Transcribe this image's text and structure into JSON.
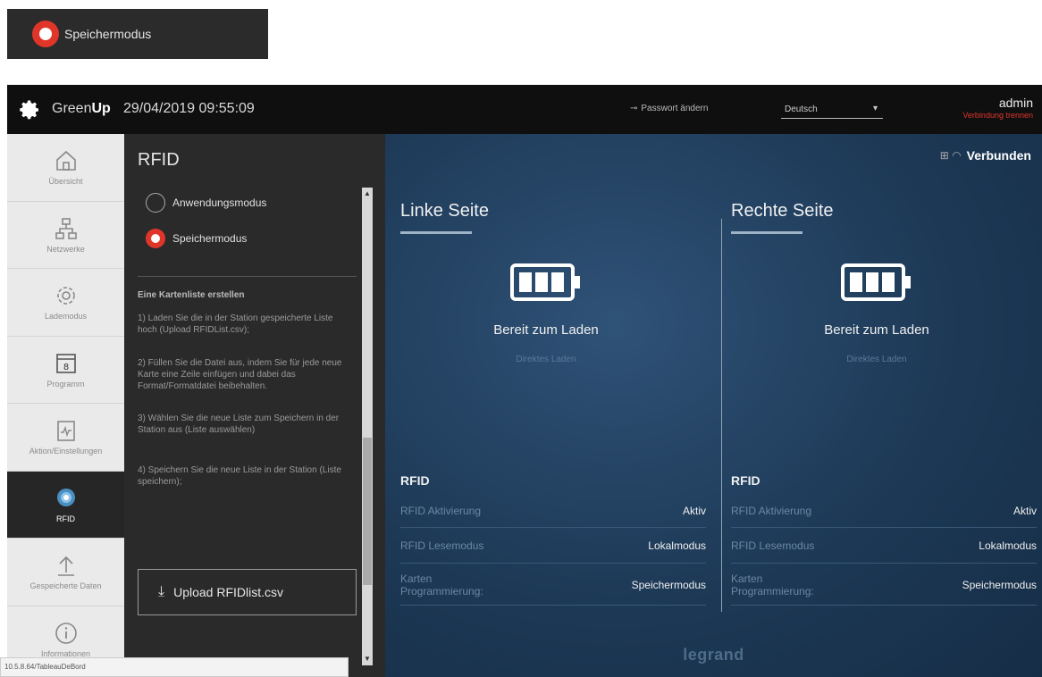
{
  "snippet": {
    "label": "Speichermodus"
  },
  "topbar": {
    "brand_plain": "Green",
    "brand_bold": "Up",
    "datetime": "29/04/2019 09:55:09",
    "password_icon": "key-icon",
    "password_label": "Passwort ändern",
    "language": "Deutsch",
    "user": "admin",
    "logout": "Verbindung trennen"
  },
  "nav": {
    "items": [
      {
        "label": "Übersicht",
        "icon": "home-icon"
      },
      {
        "label": "Netzwerke",
        "icon": "network-icon"
      },
      {
        "label": "Lademodus",
        "icon": "gear-icon"
      },
      {
        "label": "Programm",
        "icon": "calendar-icon"
      },
      {
        "label": "Aktion/Einstellungen",
        "icon": "activity-icon"
      },
      {
        "label": "RFID",
        "icon": "rfid-icon"
      },
      {
        "label": "Gespeicherte Daten",
        "icon": "upload-icon"
      },
      {
        "label": "Informationen",
        "icon": "info-icon"
      }
    ]
  },
  "rfid_panel": {
    "title": "RFID",
    "mode_app": "Anwendungsmodus",
    "mode_store": "Speichermodus",
    "heading": "Eine Kartenliste erstellen",
    "step1": "1) Laden Sie die in der Station gespeicherte Liste hoch (Upload RFIDList.csv);",
    "step2": "2) Füllen Sie die Datei aus, indem Sie für jede neue Karte eine Zeile einfügen und dabei das Format/Formatdatei beibehalten.",
    "step3": "3) Wählen Sie die neue Liste zum Speichern in der Station aus (Liste auswählen)",
    "step4": "4) Speichern Sie die neue Liste in der Station (Liste speichern);",
    "upload_label": "Upload RFIDlist.csv"
  },
  "main": {
    "status": "Verbunden",
    "left": {
      "title": "Linke Seite",
      "ready": "Bereit zum Laden",
      "sub": "Direktes Laden",
      "rfid_heading": "RFID",
      "rows": [
        {
          "k": "RFID Aktivierung",
          "v": "Aktiv"
        },
        {
          "k": "RFID Lesemodus",
          "v": "Lokalmodus"
        },
        {
          "k1": "Karten",
          "k2": "Programmierung:",
          "v": "Speichermodus"
        }
      ]
    },
    "right": {
      "title": "Rechte Seite",
      "ready": "Bereit zum Laden",
      "sub": "Direktes Laden",
      "rfid_heading": "RFID",
      "rows": [
        {
          "k": "RFID Aktivierung",
          "v": "Aktiv"
        },
        {
          "k": "RFID Lesemodus",
          "v": "Lokalmodus"
        },
        {
          "k1": "Karten",
          "k2": "Programmierung:",
          "v": "Speichermodus"
        }
      ]
    },
    "footer": "legrand"
  },
  "statusbar": {
    "url": "10.5.8.64/TableauDeBord"
  },
  "colors": {
    "accent": "#e0362a",
    "dark": "#2a2a2a",
    "dashboard": "#1d3956"
  }
}
